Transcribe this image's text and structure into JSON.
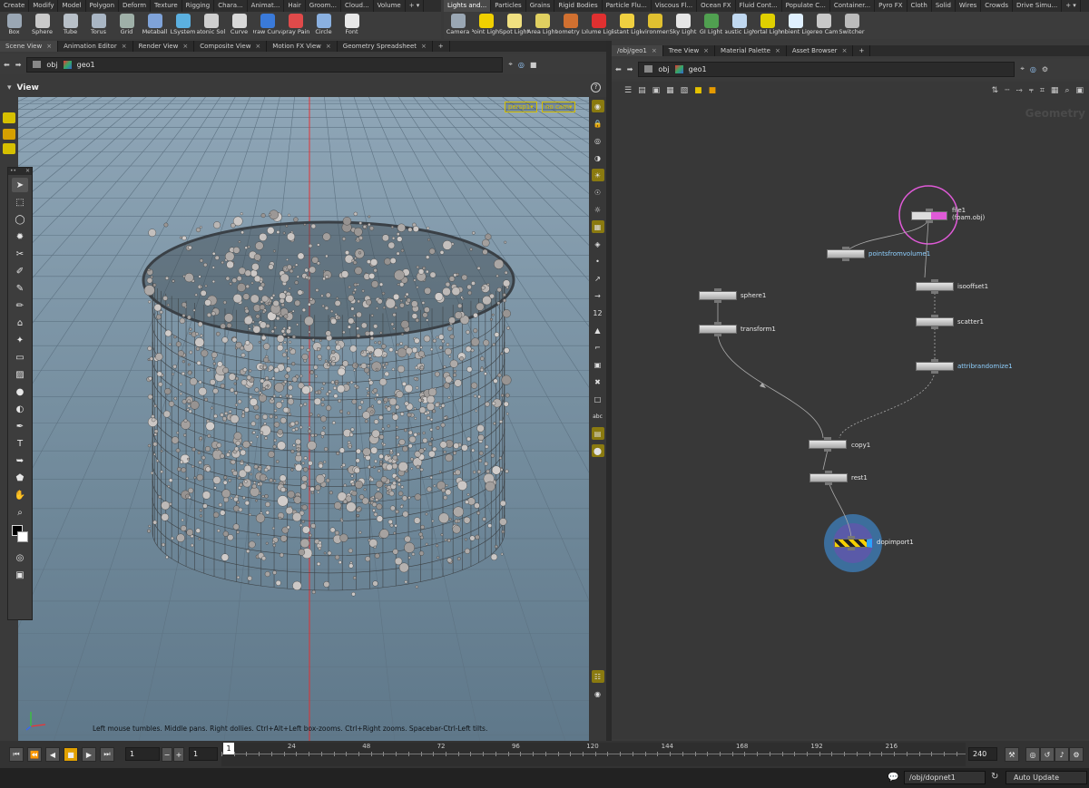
{
  "shelf_left": {
    "tabs": [
      "Create",
      "Modify",
      "Model",
      "Polygon",
      "Deform",
      "Texture",
      "Rigging",
      "Chara...",
      "Animat...",
      "Hair",
      "Groom...",
      "Cloud...",
      "Volume"
    ],
    "tools": [
      "Box",
      "Sphere",
      "Tube",
      "Torus",
      "Grid",
      "Metaball",
      "LSystem",
      "Platonic Sol...",
      "Curve",
      "Draw Curve",
      "Spray Paint",
      "Circle",
      "Font"
    ]
  },
  "shelf_right": {
    "tabs": [
      "Lights and...",
      "Particles",
      "Grains",
      "Rigid Bodies",
      "Particle Flu...",
      "Viscous Fl...",
      "Ocean FX",
      "Fluid Cont...",
      "Populate C...",
      "Container...",
      "Pyro FX",
      "Cloth",
      "Solid",
      "Wires",
      "Crowds",
      "Drive Simu..."
    ],
    "tools": [
      "Camera",
      "Point Light",
      "Spot Light",
      "Area Light",
      "Geometry L...",
      "Volume Light",
      "Distant Light",
      "Environmen...",
      "Sky Light",
      "GI Light",
      "Caustic Light",
      "Portal Light",
      "Ambient Lig...",
      "Stereo Cam...",
      "Switcher"
    ]
  },
  "left_pane": {
    "tabs": [
      "Scene View",
      "Animation Editor",
      "Render View",
      "Composite View",
      "Motion FX View",
      "Geometry Spreadsheet"
    ],
    "path": {
      "network": "obj",
      "node": "geo1"
    },
    "title": "View",
    "camera_menu": "persp1▾",
    "display_menu": "no cam▾",
    "hint": "Left mouse tumbles. Middle pans. Right dollies. Ctrl+Alt+Left box-zooms. Ctrl+Right zooms. Spacebar-Ctrl-Left tilts."
  },
  "right_pane": {
    "tabs": [
      "/obj/geo1",
      "Tree View",
      "Material Palette",
      "Asset Browser"
    ],
    "path": {
      "network": "obj",
      "node": "geo1"
    },
    "context_label": "Geometry",
    "nodes": {
      "file1": "file1",
      "file1_sub": "(foam.obj)",
      "pointsfromvolume1": "pointsfromvolume1",
      "isooffset1": "isooffset1",
      "scatter1": "scatter1",
      "attribrandomize1": "attribrandomize1",
      "sphere1": "sphere1",
      "transform1": "transform1",
      "copy1": "copy1",
      "rest1": "rest1",
      "dopimport1": "dopimport1"
    }
  },
  "timeline": {
    "current_frame": "1",
    "start_frame": "1",
    "range_start": "1",
    "end_frame": "240",
    "ticks": [
      "24",
      "48",
      "72",
      "96",
      "120",
      "144",
      "168",
      "192",
      "216"
    ],
    "marker": "1"
  },
  "status": {
    "network_path": "/obj/dopnet1",
    "update_mode": "Auto Update"
  },
  "colors": {
    "accent_yellow": "#d6c000",
    "node_select": "#e05ad8",
    "dop_blue": "#3c6e9c",
    "axis_red": "#ff2020"
  }
}
